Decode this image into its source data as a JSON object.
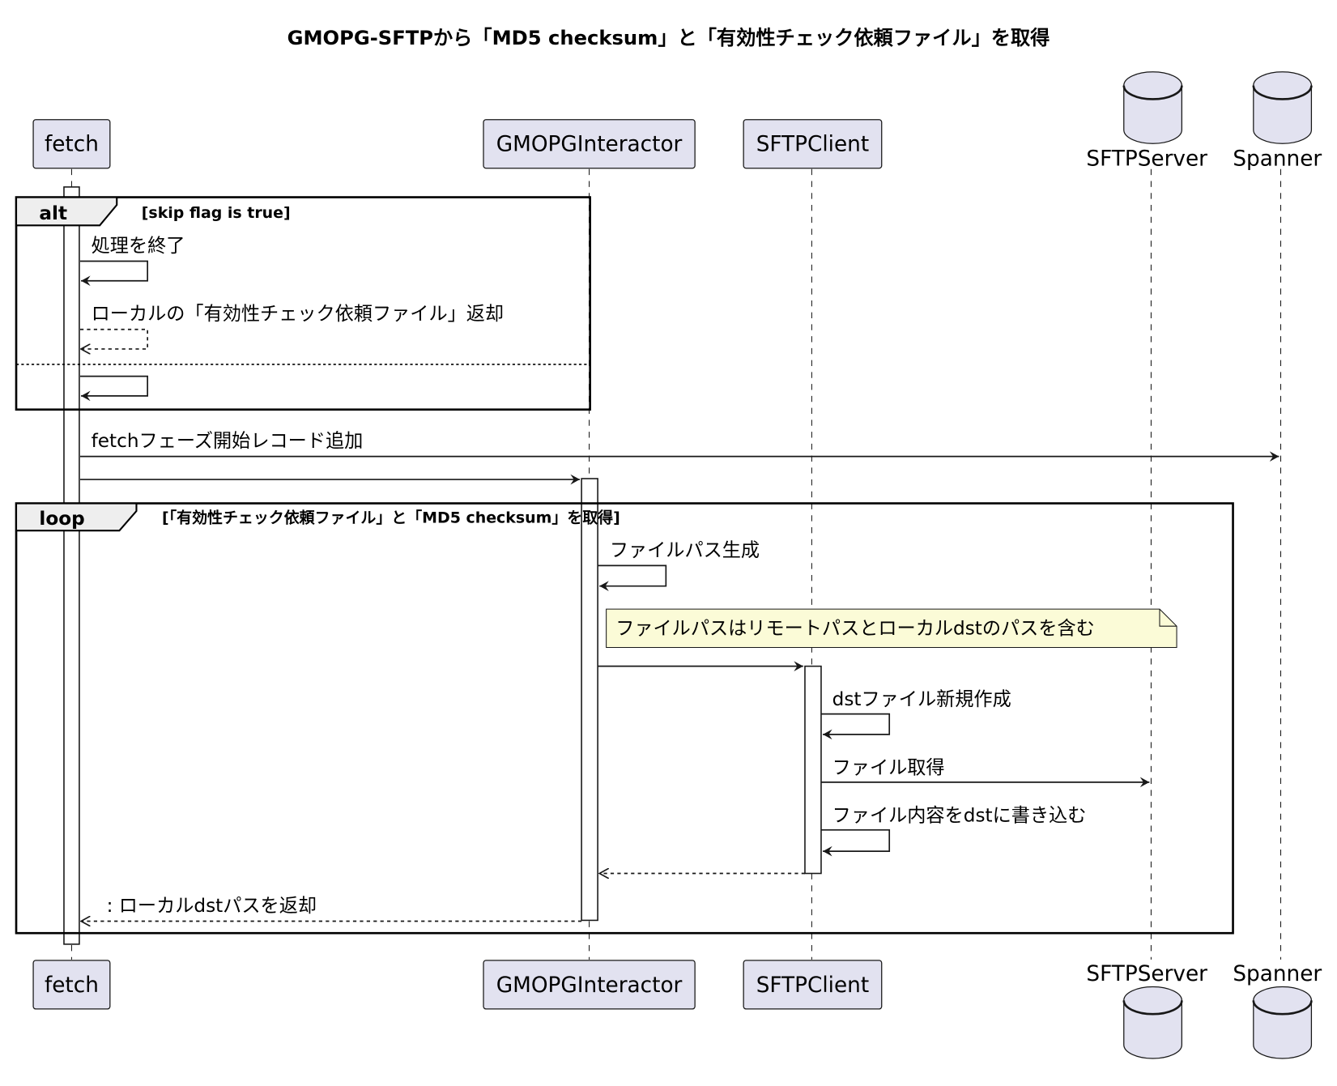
{
  "title": "GMOPG-SFTPから「MD5 checksum」と「有効性チェック依頼ファイル」を取得",
  "participants": {
    "fetch": "fetch",
    "gmopg": "GMOPGInteractor",
    "sftpclient": "SFTPClient",
    "sftpserver": "SFTPServer",
    "spanner": "Spanner"
  },
  "alt": {
    "keyword": "alt",
    "condition": "[skip flag is true]"
  },
  "loop": {
    "keyword": "loop",
    "condition": "[「有効性チェック依頼ファイル」と「MD5 checksum」を取得]"
  },
  "messages": {
    "end_processing": "処理を終了",
    "return_local": "ローカルの「有効性チェック依頼ファイル」返却",
    "add_record": "fetchフェーズ開始レコード追加",
    "gen_path": "ファイルパス生成",
    "new_dst": "dstファイル新規作成",
    "get_file": "ファイル取得",
    "write_dst": "ファイル内容をdstに書き込む",
    "return_dst": ": ローカルdstパスを返却"
  },
  "note": "ファイルパスはリモートパスとローカルdstのパスを含む",
  "colors": {
    "participant": "#e2e2f0",
    "note": "#fbfbd7"
  }
}
